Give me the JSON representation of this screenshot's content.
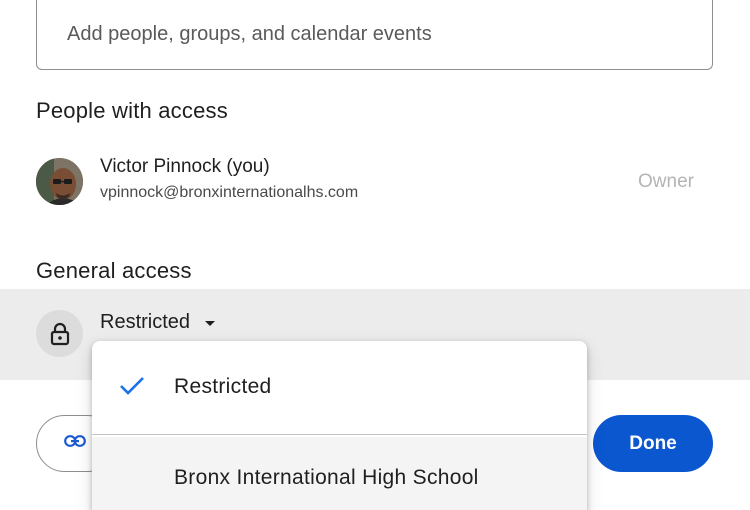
{
  "share_dialog": {
    "add_field": {
      "placeholder": "Add people, groups, and calendar events"
    },
    "people_section": {
      "heading": "People with access",
      "people": [
        {
          "name": "Victor Pinnock (you)",
          "email": "vpinnock@bronxinternationalhs.com",
          "role": "Owner"
        }
      ]
    },
    "general_access": {
      "heading": "General access",
      "selected_option": "Restricted",
      "lock_icon": "lock-icon"
    },
    "dropdown": {
      "options": [
        {
          "label": "Restricted",
          "selected": true
        },
        {
          "label": "Bronx International High School",
          "selected": false
        }
      ]
    },
    "footer": {
      "copy_link_icon": "link-icon",
      "done_label": "Done"
    }
  },
  "colors": {
    "accent": "#0b57d0",
    "check": "#1a73e8",
    "band": "#ececec",
    "muted_text": "#b4b4b4"
  }
}
